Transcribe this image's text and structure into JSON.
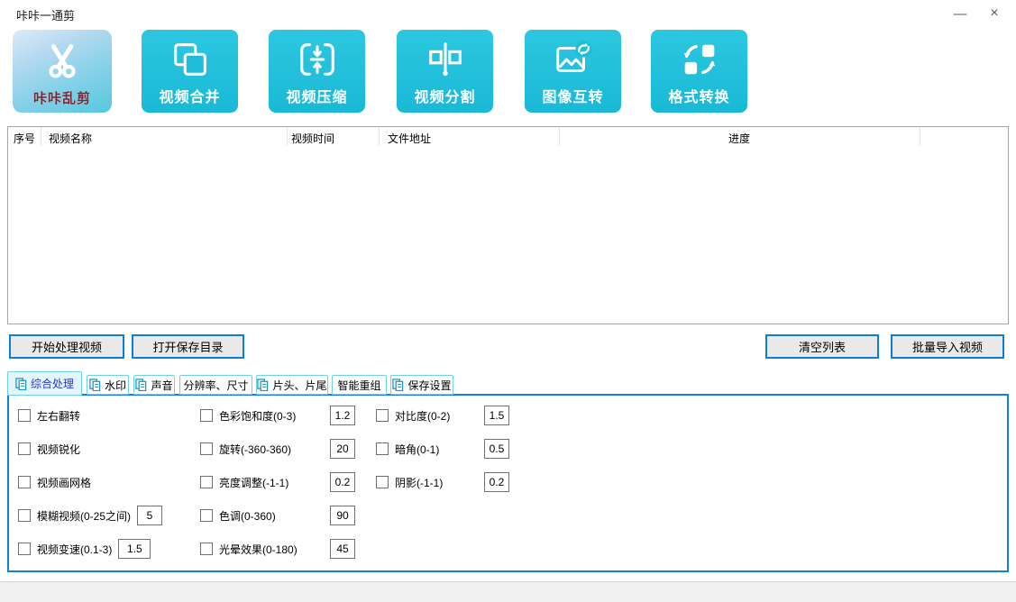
{
  "window": {
    "title": "咔咔一通剪",
    "controls": {
      "minimize": "—",
      "close": "×"
    }
  },
  "toolbar": {
    "logo": {
      "label": "咔咔乱剪",
      "icon": "scissors-icon"
    },
    "buttons": [
      {
        "label": "视频合并",
        "icon": "video-merge-icon"
      },
      {
        "label": "视频压缩",
        "icon": "video-compress-icon"
      },
      {
        "label": "视频分割",
        "icon": "video-split-icon"
      },
      {
        "label": "图像互转",
        "icon": "image-convert-icon"
      },
      {
        "label": "格式转换",
        "icon": "format-convert-icon"
      }
    ]
  },
  "table": {
    "columns": [
      "序号",
      "视频名称",
      "视频时间",
      "文件地址",
      "进度"
    ],
    "rows": []
  },
  "actions": {
    "start": "开始处理视频",
    "open_dir": "打开保存目录",
    "clear": "清空列表",
    "import": "批量导入视频"
  },
  "tabs": [
    {
      "label": "综合处理",
      "selected": true,
      "icon": "document-copy-icon"
    },
    {
      "label": "水印",
      "selected": false,
      "icon": "document-copy-icon"
    },
    {
      "label": "声音",
      "selected": false,
      "icon": "document-copy-icon"
    },
    {
      "label": "分辨率、尺寸",
      "selected": false,
      "icon": ""
    },
    {
      "label": "片头、片尾",
      "selected": false,
      "icon": "document-copy-icon"
    },
    {
      "label": "智能重组",
      "selected": false,
      "icon": ""
    },
    {
      "label": "保存设置",
      "selected": false,
      "icon": "document-copy-icon"
    }
  ],
  "settings": {
    "col1": [
      {
        "label": "左右翻转",
        "checked": false
      },
      {
        "label": "视频锐化",
        "checked": false
      },
      {
        "label": "视频画网格",
        "checked": false
      },
      {
        "label": "模糊视频(0-25之间)",
        "checked": false,
        "value": "5"
      },
      {
        "label": "视频变速(0.1-3)",
        "checked": false,
        "value": "1.5"
      }
    ],
    "col2": [
      {
        "label": "色彩饱和度(0-3)",
        "checked": false,
        "value": "1.2"
      },
      {
        "label": "旋转(-360-360)",
        "checked": false,
        "value": "20"
      },
      {
        "label": "亮度调整(-1-1)",
        "checked": false,
        "value": "0.2"
      },
      {
        "label": "色调(0-360)",
        "checked": false,
        "value": "90"
      },
      {
        "label": "光晕效果(0-180)",
        "checked": false,
        "value": "45"
      }
    ],
    "col3": [
      {
        "label": "对比度(0-2)",
        "checked": false,
        "value": "1.5"
      },
      {
        "label": "暗角(0-1)",
        "checked": false,
        "value": "0.5"
      },
      {
        "label": "阴影(-1-1)",
        "checked": false,
        "value": "0.2"
      }
    ]
  },
  "colors": {
    "accent_cyan": "#1fc0da",
    "panel_border": "#0e81df",
    "action_button_border": "#0a7edb",
    "tab_border": "#6ed0ec",
    "selected_tab_text": "#2733d8",
    "selected_tab_bg": "#e4f6fd",
    "logo_text": "#7e2836",
    "status_bar_bg": "#f0f0f0"
  }
}
